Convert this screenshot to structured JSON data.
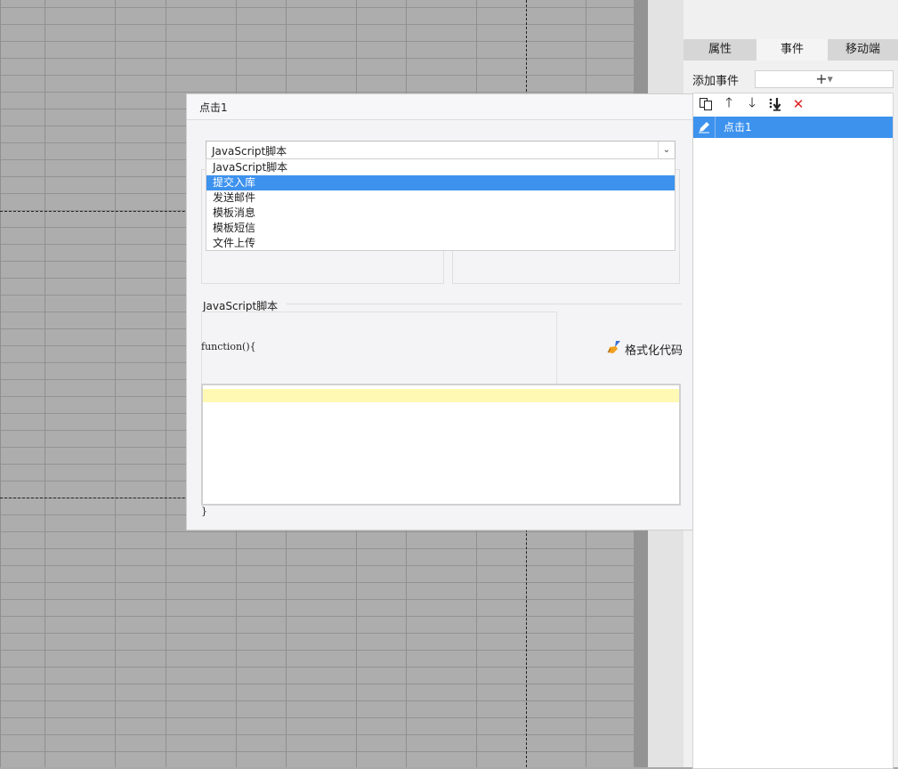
{
  "panel": {
    "tabs": [
      {
        "label": "属性"
      },
      {
        "label": "事件"
      },
      {
        "label": "移动端"
      }
    ],
    "active_tab": "事件",
    "add_event_label": "添加事件",
    "add_event_button": "+",
    "toolbar_icons": [
      "copy-icon",
      "arrow-up-icon",
      "arrow-down-icon",
      "move-bottom-icon",
      "delete-icon"
    ],
    "events": [
      {
        "name": "点击1",
        "selected": true
      }
    ]
  },
  "dialog": {
    "title": "点击1",
    "type_select": {
      "value": "JavaScript脚本",
      "options": [
        "JavaScript脚本",
        "提交入库",
        "发送邮件",
        "模板消息",
        "模板短信",
        "文件上传"
      ],
      "highlighted": "提交入库"
    },
    "script_section_label": "JavaScript脚本",
    "function_header": "function(){",
    "function_footer": "}",
    "format_button_label": "格式化代码",
    "code": ""
  },
  "colors": {
    "accent": "#3d92ee",
    "delete": "#e02020",
    "line_highlight": "#fff9b3"
  }
}
